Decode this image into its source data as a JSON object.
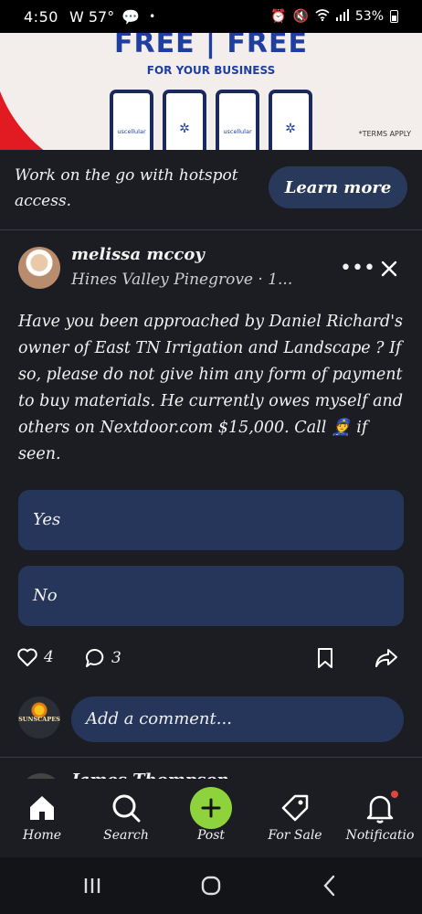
{
  "status_bar": {
    "time": "4:50",
    "weather": "W 57°",
    "notification_dot": "•",
    "battery": "53%"
  },
  "ad": {
    "headline": "FREE | FREE",
    "subheadline": "FOR YOUR BUSINESS",
    "phone_brand": "uscellular",
    "terms": "*TERMS APPLY",
    "text": "Work on the go with hotspot access.",
    "cta_label": "Learn more",
    "colors": {
      "brand_blue": "#1e3fa0",
      "brand_red": "#e21b23"
    }
  },
  "post": {
    "author": "melissa mccoy",
    "location": "Hines Valley Pinegrove · 1...",
    "body": "Have you been approached by Daniel Richard's owner of East TN Irrigation and Landscape ? If so, please do not give him any form of payment to buy materials.  He currently owes myself and others on Nextdoor.com $15,000. Call 👮 if seen.",
    "poll_options": [
      "Yes",
      "No"
    ],
    "like_count": "4",
    "comment_count": "3",
    "more_icon": "ellipsis-icon",
    "close_icon": "close-icon"
  },
  "comment": {
    "commenter_brand": "SUNSCAPES",
    "placeholder": "Add a comment..."
  },
  "next_post": {
    "author": "James Thompson"
  },
  "bottom_nav": [
    {
      "label": "Home",
      "icon": "home-icon"
    },
    {
      "label": "Search",
      "icon": "search-icon"
    },
    {
      "label": "Post",
      "icon": "plus-icon"
    },
    {
      "label": "For Sale",
      "icon": "tag-icon"
    },
    {
      "label": "Notificatio",
      "icon": "bell-icon"
    }
  ],
  "colors": {
    "background": "#1b1d22",
    "card": "#26365a",
    "post_button": "#8fd33c",
    "notification_dot": "#e2453c"
  }
}
